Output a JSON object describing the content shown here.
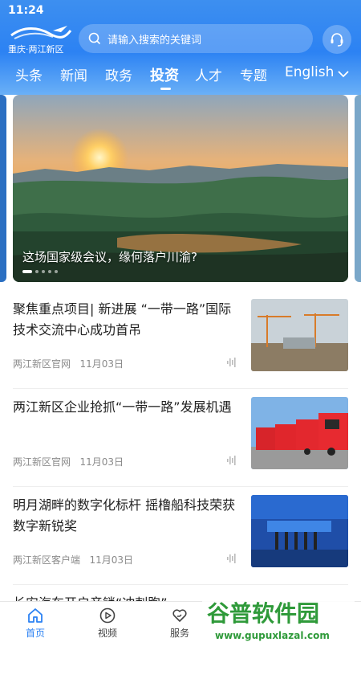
{
  "status_bar": {
    "time": "11:24"
  },
  "header": {
    "logo_text": "重庆·两江新区",
    "search_placeholder": "请输入搜索的关键词",
    "support_icon": "headset-icon"
  },
  "tabs": [
    {
      "label": "头条"
    },
    {
      "label": "新闻"
    },
    {
      "label": "政务"
    },
    {
      "label": "投资",
      "active": true
    },
    {
      "label": "人才"
    },
    {
      "label": "专题"
    },
    {
      "label": "English"
    }
  ],
  "banner": {
    "caption": "这场国家级会议，缘何落户川渝?",
    "slides_total": 5,
    "active_slide": 1
  },
  "news": [
    {
      "title": "聚焦重点项目| 新进展 “一带一路”国际技术交流中心成功首吊",
      "source": "两江新区官网",
      "date": "11月03日"
    },
    {
      "title": "两江新区企业抢抓“一带一路”发展机遇",
      "source": "两江新区官网",
      "date": "11月03日"
    },
    {
      "title": "明月湖畔的数字化标杆 摇橹船科技荣获数字新锐奖",
      "source": "两江新区客户端",
      "date": "11月03日"
    },
    {
      "title": "长安汽车开启音锁“冲刺跑”"
    }
  ],
  "bottom_nav": [
    {
      "label": "首页",
      "icon": "home-icon",
      "active": true
    },
    {
      "label": "视频",
      "icon": "play-icon"
    },
    {
      "label": "服务",
      "icon": "heart-hand-icon"
    }
  ],
  "watermark": {
    "cn": "谷普软件园",
    "url": "www.gupuxlazal.com"
  },
  "colors": {
    "accent": "#2c82f3"
  }
}
